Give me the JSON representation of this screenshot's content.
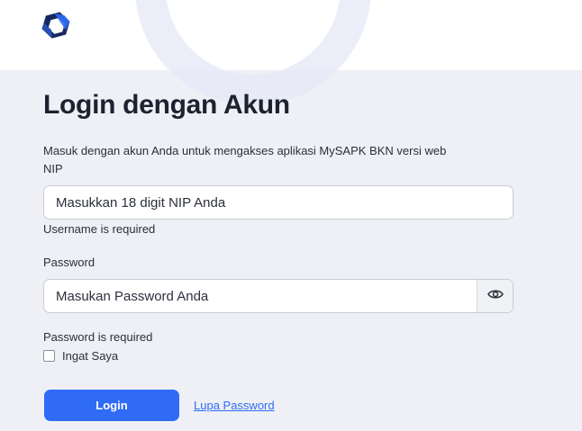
{
  "header": {
    "logo_icon": "mysapk-logo-icon"
  },
  "login": {
    "title": "Login dengan Akun",
    "subtitle": "Masuk dengan akun Anda untuk mengakses aplikasi MySAPK BKN versi web",
    "nip_label": "NIP",
    "nip_placeholder": "Masukkan 18 digit NIP Anda",
    "nip_value": "",
    "nip_error": "Username is required",
    "password_label": "Password",
    "password_placeholder": "Masukan Password Anda",
    "password_value": "",
    "password_error": "Password is required",
    "toggle_icon": "eye-icon",
    "remember_label": "Ingat Saya",
    "remember_checked": false,
    "login_button": "Login",
    "forgot_link": "Lupa Password"
  },
  "colors": {
    "primary": "#2f6bf5",
    "background": "#eef0f5",
    "logo_dark": "#16295e",
    "logo_light": "#2f6bf5"
  }
}
